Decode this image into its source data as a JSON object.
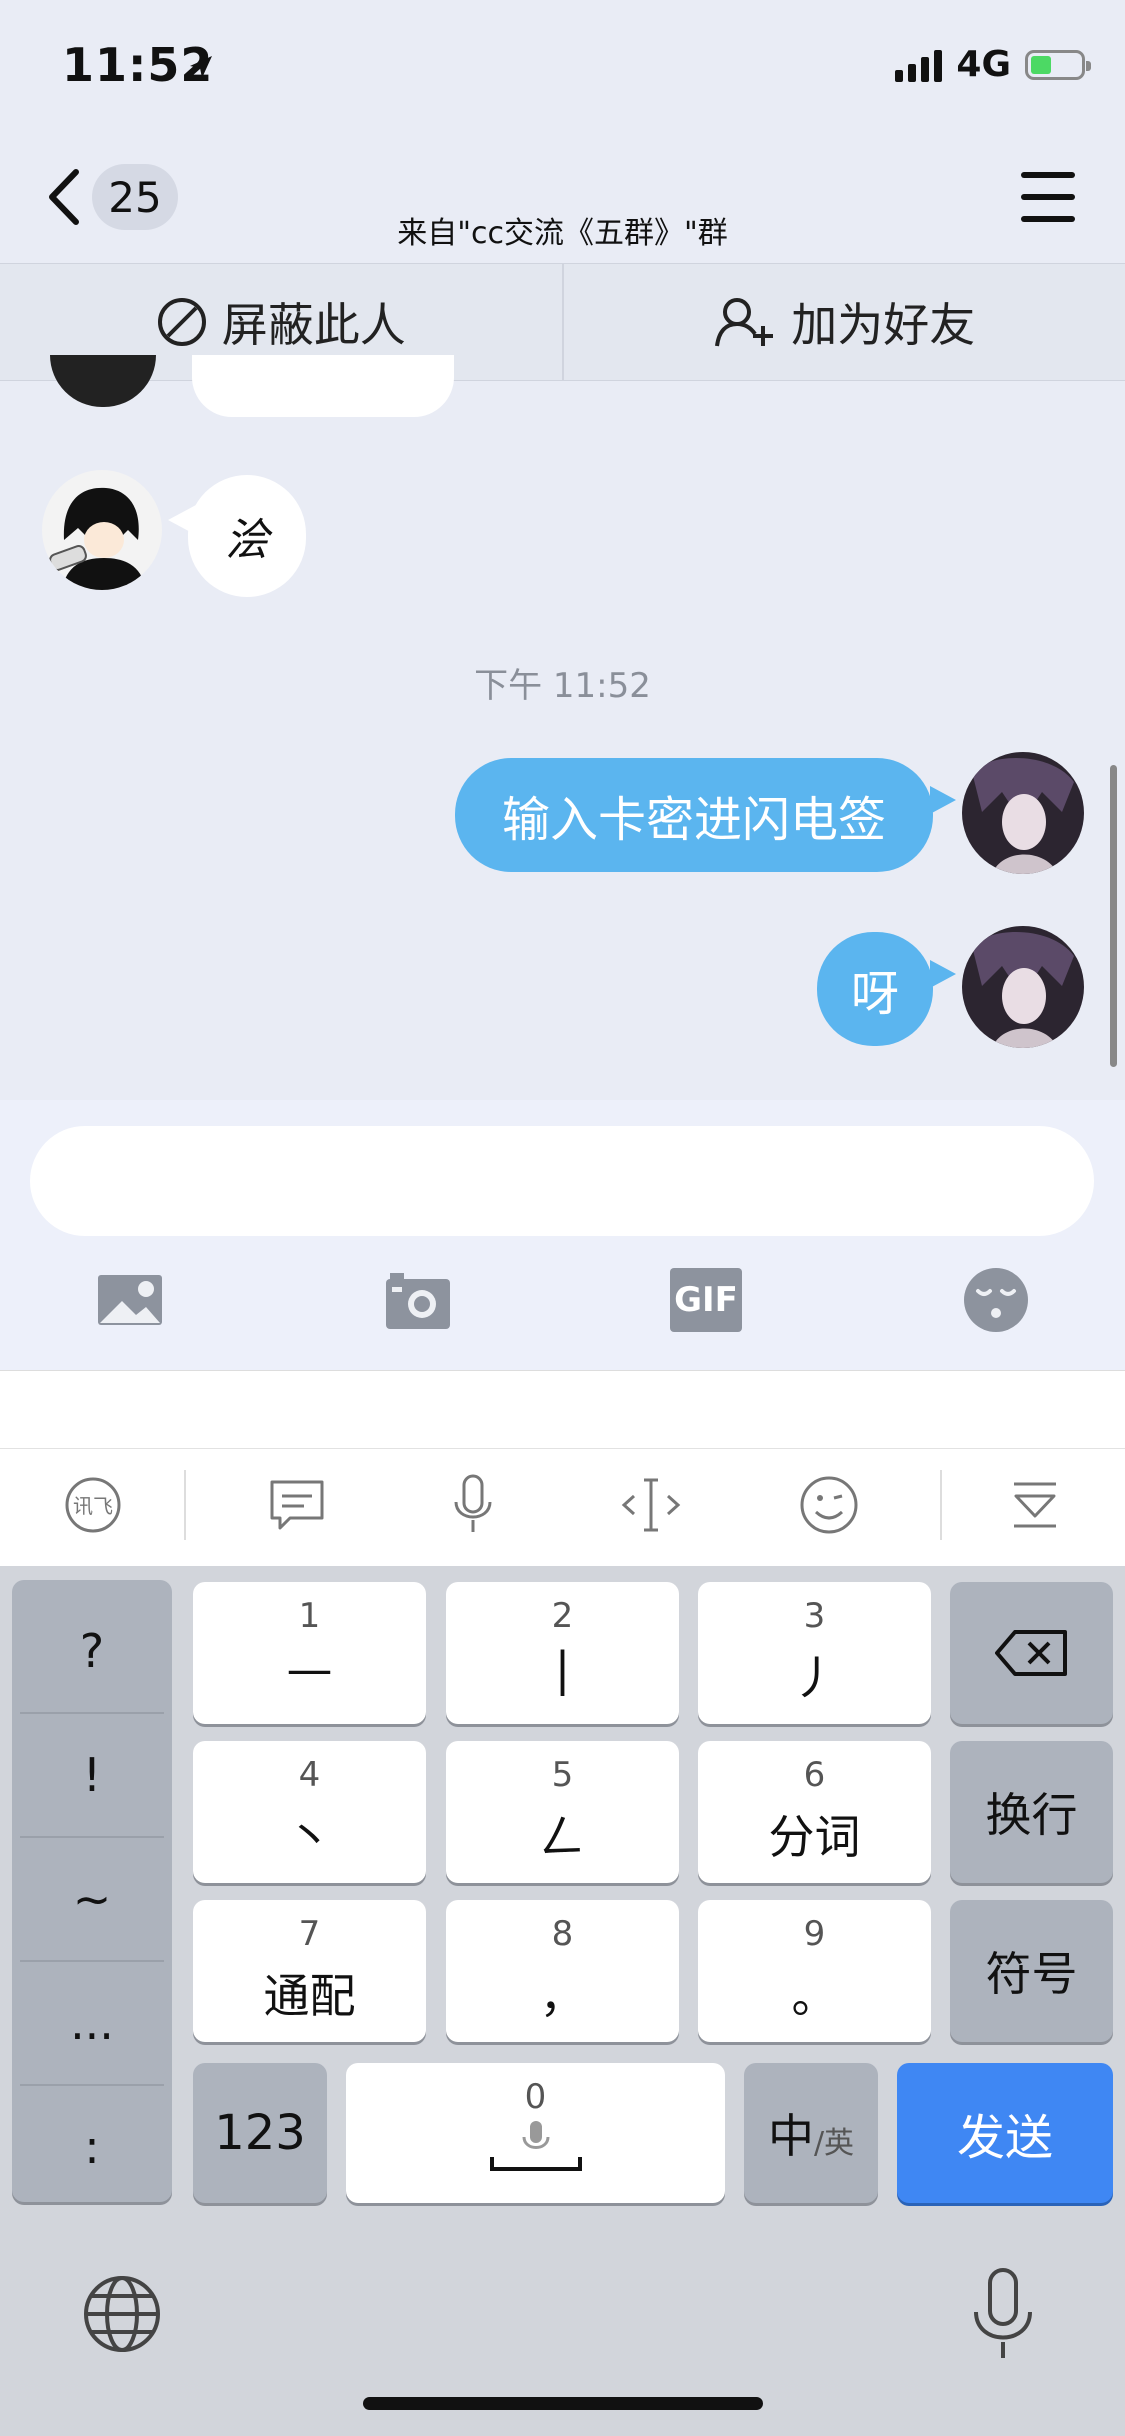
{
  "status_bar": {
    "time": "11:52",
    "network": "4G"
  },
  "nav": {
    "unread_count": "25",
    "title": "来自\"cc交流《五群》\"群"
  },
  "actions": {
    "block_label": "屏蔽此人",
    "add_friend_label": "加为好友"
  },
  "chat": {
    "incoming_message": "浍",
    "timestamp": "下午 11:52",
    "outgoing_messages": [
      "输入卡密进闪电签",
      "呀"
    ]
  },
  "composer": {
    "tools": [
      "image-icon",
      "camera-icon",
      "gif-icon",
      "emoji-icon"
    ],
    "gif_label": "GIF"
  },
  "keyboard": {
    "symbols": [
      "?",
      "!",
      "~",
      "...",
      ":"
    ],
    "keys": [
      {
        "num": "1",
        "label": "—"
      },
      {
        "num": "2",
        "label": "|"
      },
      {
        "num": "3",
        "label": "丿"
      },
      {
        "num": "4",
        "label": "丶"
      },
      {
        "num": "5",
        "label": "𠃋"
      },
      {
        "num": "6",
        "label": "分词"
      },
      {
        "num": "7",
        "label": "通配"
      },
      {
        "num": "8",
        "label": "，"
      },
      {
        "num": "9",
        "label": "。"
      }
    ],
    "newline_label": "换行",
    "symbols_label": "符号",
    "num_mode_label": "123",
    "space_num": "0",
    "lang_main": "中",
    "lang_alt": "/英",
    "send_label": "发送"
  }
}
